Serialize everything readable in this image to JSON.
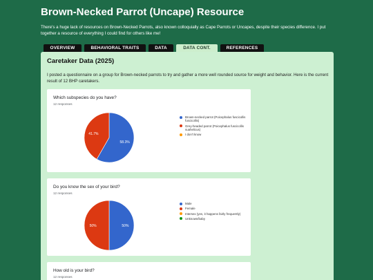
{
  "page": {
    "title": "Brown-Necked Parrot (Uncape) Resource",
    "intro": "There's a huge lack of resources on Brown-Necked Parrots, also known colloquially as Cape Parrots or Uncapes, despite their species difference. I put together a resource of everything I could find for others like me!"
  },
  "tabs": [
    {
      "label": "OVERVIEW",
      "active": false
    },
    {
      "label": "BEHAVIORAL TRAITS",
      "active": false
    },
    {
      "label": "DATA",
      "active": false
    },
    {
      "label": "DATA CONT.",
      "active": true
    },
    {
      "label": "REFERENCES",
      "active": false
    }
  ],
  "section": {
    "title": "Caretaker Data (2025)",
    "description": "I posted a questionnaire on a group for Brown-necked parrots to try and gather a more well rounded source for weight and behavior. Here is the current result of 12 BHP caretakers."
  },
  "cards": [
    {
      "question": "Which subspecies do you have?",
      "responses": "12 responses",
      "legend": [
        {
          "label": "Brown-necked parrot (Poicephalus fuscicollis fuscicollis)",
          "color": "#3366cc"
        },
        {
          "label": "Grey-headed parrot (Poicephalus fuscicollis suahelicus)",
          "color": "#dc3912"
        },
        {
          "label": "I don't know",
          "color": "#ff9900"
        }
      ]
    },
    {
      "question": "Do you know the sex of your bird?",
      "responses": "12 responses",
      "legend": [
        {
          "label": "Male",
          "color": "#3366cc"
        },
        {
          "label": "Female",
          "color": "#dc3912"
        },
        {
          "label": "Intersex (yes, it happens fairly frequently)",
          "color": "#ff9900"
        },
        {
          "label": "Unknown/baby",
          "color": "#109618"
        }
      ]
    },
    {
      "question": "How old is your bird?",
      "responses": "12 responses"
    }
  ],
  "chart_data": [
    {
      "type": "pie",
      "categories": [
        "Brown-necked parrot (Poicephalus fuscicollis fuscicollis)",
        "Grey-headed parrot (Poicephalus fuscicollis suahelicus)",
        "I don't know"
      ],
      "values": [
        58.3,
        41.7,
        0
      ],
      "slice_labels": [
        "58.3%",
        "41.7%"
      ],
      "colors": [
        "#3366cc",
        "#dc3912",
        "#ff9900"
      ]
    },
    {
      "type": "pie",
      "categories": [
        "Male",
        "Female",
        "Intersex (yes, it happens fairly frequently)",
        "Unknown/baby"
      ],
      "values": [
        50,
        50,
        0,
        0
      ],
      "slice_labels": [
        "50%",
        "50%"
      ],
      "colors": [
        "#3366cc",
        "#dc3912",
        "#ff9900",
        "#109618"
      ]
    }
  ]
}
